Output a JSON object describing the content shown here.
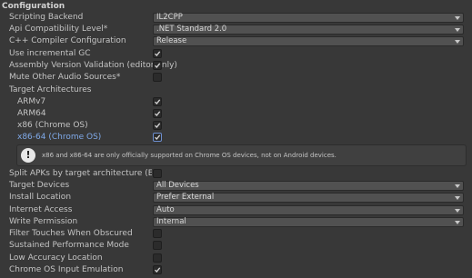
{
  "section": {
    "title": "Configuration"
  },
  "fields": {
    "scripting_backend": {
      "label": "Scripting Backend",
      "value": "IL2CPP"
    },
    "api_compat": {
      "label": "Api Compatibility Level*",
      "value": ".NET Standard 2.0"
    },
    "cpp_config": {
      "label": "C++ Compiler Configuration",
      "value": "Release"
    },
    "incremental_gc": {
      "label": "Use incremental GC",
      "checked": true
    },
    "assembly_validation": {
      "label": "Assembly Version Validation (editor only)",
      "checked": true
    },
    "mute_audio": {
      "label": "Mute Other Audio Sources*",
      "checked": false
    },
    "target_arch": {
      "label": "Target Architectures"
    },
    "armv7": {
      "label": "ARMv7",
      "checked": true
    },
    "arm64": {
      "label": "ARM64",
      "checked": true
    },
    "x86": {
      "label": "x86 (Chrome OS)",
      "checked": true
    },
    "x86_64": {
      "label": "x86-64 (Chrome OS)",
      "checked": true
    },
    "split_apks": {
      "label": "Split APKs by target architecture (Experime",
      "checked": false
    },
    "target_devices": {
      "label": "Target Devices",
      "value": "All Devices"
    },
    "install_location": {
      "label": "Install Location",
      "value": "Prefer External"
    },
    "internet_access": {
      "label": "Internet Access",
      "value": "Auto"
    },
    "write_permission": {
      "label": "Write Permission",
      "value": "Internal"
    },
    "filter_touches": {
      "label": "Filter Touches When Obscured",
      "checked": false
    },
    "sustained_perf": {
      "label": "Sustained Performance Mode",
      "checked": false
    },
    "low_accuracy": {
      "label": "Low Accuracy Location",
      "checked": false
    },
    "chromeos_input": {
      "label": "Chrome OS Input Emulation",
      "checked": true
    }
  },
  "help": {
    "message": "x86 and x86-64 are only officially supported on Chrome OS devices, not on Android devices.",
    "icon": "warning-icon"
  },
  "colors": {
    "background": "#383838",
    "highlight": "#7fa9e8"
  }
}
